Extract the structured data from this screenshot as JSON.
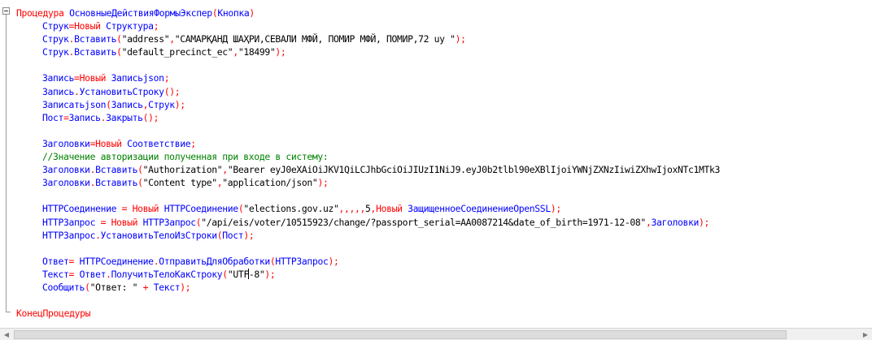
{
  "editor": {
    "lines": [
      {
        "indent": false,
        "tokens": [
          {
            "t": "Процедура",
            "c": "k"
          },
          {
            "t": " ",
            "c": "b"
          },
          {
            "t": "ОсновныеДействияФормыЭкспер",
            "c": "b"
          },
          {
            "t": "(",
            "c": "k"
          },
          {
            "t": "Кнопка",
            "c": "b"
          },
          {
            "t": ")",
            "c": "k"
          }
        ]
      },
      {
        "indent": true,
        "tokens": [
          {
            "t": "Струк",
            "c": "b"
          },
          {
            "t": "=",
            "c": "k"
          },
          {
            "t": "Новый",
            "c": "k"
          },
          {
            "t": " Структура",
            "c": "b"
          },
          {
            "t": ";",
            "c": "k"
          }
        ]
      },
      {
        "indent": true,
        "tokens": [
          {
            "t": "Струк",
            "c": "b"
          },
          {
            "t": ".",
            "c": "k"
          },
          {
            "t": "Вставить",
            "c": "b"
          },
          {
            "t": "(",
            "c": "k"
          },
          {
            "t": "\"address\"",
            "c": "s"
          },
          {
            "t": ",",
            "c": "k"
          },
          {
            "t": "\"САМАРҚАНД ШАҲРИ,СЕВАЛИ МФЙ, ПОМИР МФЙ, ПОМИР,72 uy \"",
            "c": "s"
          },
          {
            "t": ");",
            "c": "k"
          }
        ]
      },
      {
        "indent": true,
        "tokens": [
          {
            "t": "Струк",
            "c": "b"
          },
          {
            "t": ".",
            "c": "k"
          },
          {
            "t": "Вставить",
            "c": "b"
          },
          {
            "t": "(",
            "c": "k"
          },
          {
            "t": "\"default_precinct_ec\"",
            "c": "s"
          },
          {
            "t": ",",
            "c": "k"
          },
          {
            "t": "\"18499\"",
            "c": "s"
          },
          {
            "t": ");",
            "c": "k"
          }
        ]
      },
      {
        "indent": true,
        "tokens": []
      },
      {
        "indent": true,
        "tokens": [
          {
            "t": "Запись",
            "c": "b"
          },
          {
            "t": "=",
            "c": "k"
          },
          {
            "t": "Новый",
            "c": "k"
          },
          {
            "t": " Записьjson",
            "c": "b"
          },
          {
            "t": ";",
            "c": "k"
          }
        ]
      },
      {
        "indent": true,
        "tokens": [
          {
            "t": "Запись",
            "c": "b"
          },
          {
            "t": ".",
            "c": "k"
          },
          {
            "t": "УстановитьСтроку",
            "c": "b"
          },
          {
            "t": "();",
            "c": "k"
          }
        ]
      },
      {
        "indent": true,
        "tokens": [
          {
            "t": "Записатьjson",
            "c": "b"
          },
          {
            "t": "(",
            "c": "k"
          },
          {
            "t": "Запись",
            "c": "b"
          },
          {
            "t": ",",
            "c": "k"
          },
          {
            "t": "Струк",
            "c": "b"
          },
          {
            "t": ");",
            "c": "k"
          }
        ]
      },
      {
        "indent": true,
        "tokens": [
          {
            "t": "Пост",
            "c": "b"
          },
          {
            "t": "=",
            "c": "k"
          },
          {
            "t": "Запись",
            "c": "b"
          },
          {
            "t": ".",
            "c": "k"
          },
          {
            "t": "Закрыть",
            "c": "b"
          },
          {
            "t": "();",
            "c": "k"
          }
        ]
      },
      {
        "indent": true,
        "tokens": []
      },
      {
        "indent": true,
        "tokens": [
          {
            "t": "Заголовки",
            "c": "b"
          },
          {
            "t": "=",
            "c": "k"
          },
          {
            "t": "Новый",
            "c": "k"
          },
          {
            "t": " Соответствие",
            "c": "b"
          },
          {
            "t": ";",
            "c": "k"
          }
        ]
      },
      {
        "indent": true,
        "tokens": [
          {
            "t": "//Значение авторизации полученная при входе в систему:",
            "c": "c"
          }
        ]
      },
      {
        "indent": true,
        "tokens": [
          {
            "t": "Заголовки",
            "c": "b"
          },
          {
            "t": ".",
            "c": "k"
          },
          {
            "t": "Вставить",
            "c": "b"
          },
          {
            "t": "(",
            "c": "k"
          },
          {
            "t": "\"Authorization\"",
            "c": "s"
          },
          {
            "t": ",",
            "c": "k"
          },
          {
            "t": "\"Bearer eyJ0eXAiOiJKV1QiLCJhbGciOiJIUzI1NiJ9.eyJ0b2tlbl90eXBlIjoiYWNjZXNzIiwiZXhwIjoxNTc1MTk3",
            "c": "s"
          }
        ]
      },
      {
        "indent": true,
        "tokens": [
          {
            "t": "Заголовки",
            "c": "b"
          },
          {
            "t": ".",
            "c": "k"
          },
          {
            "t": "Вставить",
            "c": "b"
          },
          {
            "t": "(",
            "c": "k"
          },
          {
            "t": "\"Content type\"",
            "c": "s"
          },
          {
            "t": ",",
            "c": "k"
          },
          {
            "t": "\"application/json\"",
            "c": "s"
          },
          {
            "t": ");",
            "c": "k"
          }
        ]
      },
      {
        "indent": true,
        "tokens": []
      },
      {
        "indent": true,
        "tokens": [
          {
            "t": "HTTPСоединение ",
            "c": "b"
          },
          {
            "t": "=",
            "c": "k"
          },
          {
            "t": " ",
            "c": "b"
          },
          {
            "t": "Новый",
            "c": "k"
          },
          {
            "t": " HTTPСоединение",
            "c": "b"
          },
          {
            "t": "(",
            "c": "k"
          },
          {
            "t": "\"elections.gov.uz\"",
            "c": "s"
          },
          {
            "t": ",,,,,",
            "c": "k"
          },
          {
            "t": "5",
            "c": "s"
          },
          {
            "t": ",",
            "c": "k"
          },
          {
            "t": "Новый",
            "c": "k"
          },
          {
            "t": " ЗащищенноеСоединениеOpenSSL",
            "c": "b"
          },
          {
            "t": ");",
            "c": "k"
          }
        ]
      },
      {
        "indent": true,
        "tokens": [
          {
            "t": "HTTPЗапрос ",
            "c": "b"
          },
          {
            "t": "=",
            "c": "k"
          },
          {
            "t": " ",
            "c": "b"
          },
          {
            "t": "Новый",
            "c": "k"
          },
          {
            "t": " HTTPЗапрос",
            "c": "b"
          },
          {
            "t": "(",
            "c": "k"
          },
          {
            "t": "\"/api/eis/voter/10515923/change/?passport_serial=AA0087214&date_of_birth=1971-12-08\"",
            "c": "s"
          },
          {
            "t": ",",
            "c": "k"
          },
          {
            "t": "Заголовки",
            "c": "b"
          },
          {
            "t": ");",
            "c": "k"
          }
        ]
      },
      {
        "indent": true,
        "tokens": [
          {
            "t": "HTTPЗапрос",
            "c": "b"
          },
          {
            "t": ".",
            "c": "k"
          },
          {
            "t": "УстановитьТелоИзСтроки",
            "c": "b"
          },
          {
            "t": "(",
            "c": "k"
          },
          {
            "t": "Пост",
            "c": "b"
          },
          {
            "t": ");",
            "c": "k"
          }
        ]
      },
      {
        "indent": true,
        "tokens": []
      },
      {
        "indent": true,
        "tokens": [
          {
            "t": "Ответ",
            "c": "b"
          },
          {
            "t": "=",
            "c": "k"
          },
          {
            "t": " HTTPСоединение",
            "c": "b"
          },
          {
            "t": ".",
            "c": "k"
          },
          {
            "t": "ОтправитьДляОбработки",
            "c": "b"
          },
          {
            "t": "(",
            "c": "k"
          },
          {
            "t": "HTTPЗапрос",
            "c": "b"
          },
          {
            "t": ");",
            "c": "k"
          }
        ]
      },
      {
        "indent": true,
        "caretAfter": 8,
        "tokens": [
          {
            "t": "Текст",
            "c": "b"
          },
          {
            "t": "=",
            "c": "k"
          },
          {
            "t": " Ответ",
            "c": "b"
          },
          {
            "t": ".",
            "c": "k"
          },
          {
            "t": "ПолучитьТелоКакСтроку",
            "c": "b"
          },
          {
            "t": "(",
            "c": "k"
          },
          {
            "t": "\"UTF",
            "c": "s"
          },
          {
            "t": "-8\"",
            "c": "s"
          },
          {
            "t": ");",
            "c": "k"
          }
        ]
      },
      {
        "indent": true,
        "tokens": [
          {
            "t": "Сообщить",
            "c": "b"
          },
          {
            "t": "(",
            "c": "k"
          },
          {
            "t": "\"Ответ: \"",
            "c": "s"
          },
          {
            "t": " + ",
            "c": "k"
          },
          {
            "t": "Текст",
            "c": "b"
          },
          {
            "t": ");",
            "c": "k"
          }
        ]
      },
      {
        "indent": false,
        "tokens": []
      },
      {
        "indent": false,
        "tokens": [
          {
            "t": "КонецПроцедуры",
            "c": "k"
          }
        ]
      }
    ]
  },
  "colors": {
    "keyword": "#ff0000",
    "identifier": "#0000ff",
    "comment": "#008000",
    "string": "#000000"
  },
  "scrollbar": {
    "left_icon": "arrow-left-icon",
    "right_icon": "arrow-right-icon",
    "left_glyph": "◀",
    "right_glyph": "▶"
  }
}
